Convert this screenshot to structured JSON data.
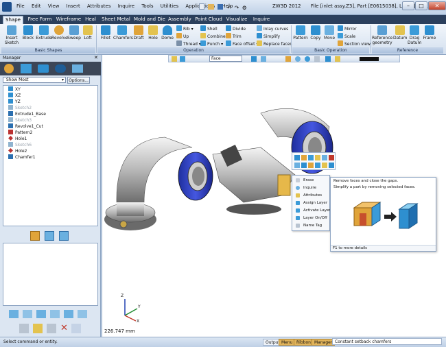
{
  "app": {
    "window_title": "ZW3D 2012",
    "file_info": "File [inlet assy.Z3], Part [E0615038], Layer [Defa..."
  },
  "menu": [
    "File",
    "Edit",
    "View",
    "Insert",
    "Attributes",
    "Inquire",
    "Tools",
    "Utilities",
    "Applications",
    "Help"
  ],
  "tabs": [
    "Shape",
    "Free Form",
    "Wireframe",
    "Heal",
    "Sheet Metal",
    "Mold and Die",
    "Assembly",
    "Point Cloud",
    "Visualize",
    "Inquire"
  ],
  "active_tab": "Shape",
  "ribbon": {
    "basic_shapes": {
      "label": "Basic Shapes",
      "buttons": [
        "Insert Sketch",
        "Block",
        "Extrude",
        "Revolve",
        "Sweep",
        "Loft"
      ]
    },
    "operation": {
      "label": "Operation",
      "buttons": [
        "Fillet",
        "Chamfers",
        "Draft",
        "Hole",
        "Dome"
      ],
      "small": [
        "Rib",
        "Up",
        "Thread",
        "Shell",
        "Combine",
        "Punch",
        "Divide",
        "Trim",
        "Face offset",
        "Inlay curves",
        "Simplify",
        "Replace faces"
      ]
    },
    "basic_operation": {
      "label": "Basic Operation",
      "buttons": [
        "Pattern",
        "Copy",
        "Move"
      ],
      "small": [
        "Mirror",
        "Scale",
        "Section view"
      ]
    },
    "reference": {
      "label": "Reference",
      "buttons": [
        "Reference geometry",
        "Datum",
        "Drag Datum",
        "Frame"
      ]
    }
  },
  "manager": {
    "title": "Manager",
    "filter": "Show Most",
    "options_label": "Options...",
    "tree": [
      {
        "label": "XY",
        "dim": false,
        "color": "#2e8fd0"
      },
      {
        "label": "XZ",
        "dim": false,
        "color": "#2e8fd0"
      },
      {
        "label": "YZ",
        "dim": false,
        "color": "#2e8fd0"
      },
      {
        "label": "Sketch2",
        "dim": true,
        "color": "#8fb3cf"
      },
      {
        "label": "Extrude1_Base",
        "dim": false,
        "color": "#2b6fb0"
      },
      {
        "label": "Sketch3",
        "dim": true,
        "color": "#8fb3cf"
      },
      {
        "label": "Revolve1_Cut",
        "dim": false,
        "color": "#2b6fb0"
      },
      {
        "label": "Pattern2",
        "dim": false,
        "color": "#b33"
      },
      {
        "label": "Hole1",
        "dim": false,
        "color": "#b33"
      },
      {
        "label": "Sketch6",
        "dim": true,
        "color": "#8fb3cf"
      },
      {
        "label": "Hole2",
        "dim": false,
        "color": "#b33"
      },
      {
        "label": "Chamfer1",
        "dim": false,
        "color": "#2b6fb0"
      }
    ]
  },
  "viewport": {
    "filter": "Face",
    "distance": "226.747 mm",
    "axes": {
      "x": "X",
      "y": "Y",
      "z": "Z"
    }
  },
  "context_menu": [
    "Erase",
    "Inquire",
    "Attributes",
    "Assign Layer",
    "Activate Layer",
    "Layer On/Off",
    "Name Tag"
  ],
  "tooltip": {
    "title": "Remove faces and close the gaps.",
    "description": "Simplify a part by removing selected faces.",
    "footer": "F1 to more details"
  },
  "status": {
    "message": "Select command or entity.",
    "tabs": [
      "Output",
      "Menu",
      "Ribbon",
      "Manager"
    ],
    "hint": "Constant setback chamfers"
  }
}
